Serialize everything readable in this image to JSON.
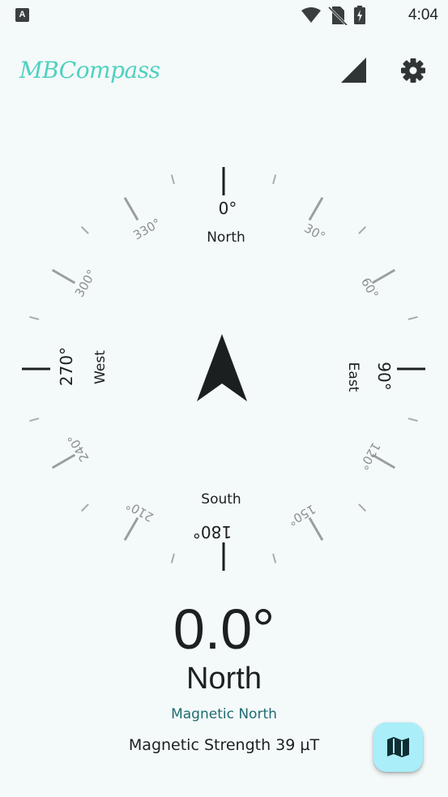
{
  "status_bar": {
    "app_indicator": "A",
    "time": "4:04",
    "icons": [
      "wifi-icon",
      "no-sim-icon",
      "battery-charging-icon"
    ]
  },
  "app_bar": {
    "title": "MBCompass",
    "actions": [
      "signal-icon",
      "settings-gear-icon"
    ]
  },
  "compass": {
    "heading_deg": 0,
    "cardinals": {
      "north": "North",
      "east": "East",
      "south": "South",
      "west": "West"
    },
    "degree_labels": {
      "d0": "0°",
      "d30": "30°",
      "d60": "60°",
      "d90": "90°",
      "d120": "120°",
      "d150": "150°",
      "d180": "180°",
      "d210": "210°",
      "d240": "240°",
      "d270": "270°",
      "d300": "300°",
      "d330": "330°"
    },
    "colors": {
      "major_tick": "#1b1f1f",
      "minor_tick": "#9a9e9e",
      "arrow": "#1b1f1f"
    }
  },
  "readout": {
    "degrees": "0.0°",
    "direction": "North",
    "north_type": "Magnetic North",
    "magnetic_strength": "Magnetic Strength 39 µT"
  },
  "fab": {
    "icon": "map-icon"
  },
  "theme": {
    "background": "#f4f9f9",
    "accent": "#4fd1c0",
    "fab": "#a9eef8",
    "link": "#1f6c72"
  }
}
